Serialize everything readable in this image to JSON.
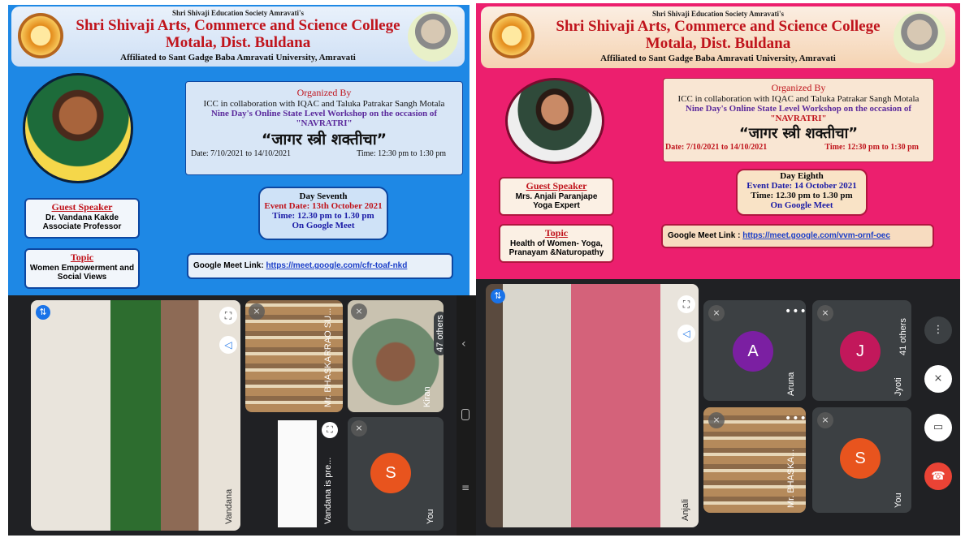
{
  "left": {
    "poster": {
      "society": "Shri Shivaji Education Society Amravati's",
      "college_line1": "Shri Shivaji Arts, Commerce and Science College",
      "college_line2": "Motala, Dist. Buldana",
      "affiliated": "Affiliated to Sant Gadge Baba Amravati University, Amravati",
      "organized_by": "Organized By",
      "collab": "ICC in collaboration with IQAC and Taluka Patrakar Sangh Motala",
      "workshop": "Nine Day's Online State Level Workshop on the occasion of",
      "navratri": "\"NAVRATRI\"",
      "marathi_title": "“जागर स्त्री शक्तीचा”",
      "date": "Date: 7/10/2021 to 14/10/2021",
      "time": "Time: 12:30 pm to 1:30 pm",
      "day": "Day Seventh",
      "event_date": "Event Date: 13th October 2021",
      "event_time": "Time: 12.30 pm  to 1.30 pm",
      "platform": "On Google Meet",
      "guest_heading": "Guest Speaker",
      "guest_name": "Dr. Vandana Kakde",
      "guest_role": "Associate Professor",
      "topic_heading": "Topic",
      "topic_line1": "Women Empowerment and",
      "topic_line2": "Social Views",
      "meet_label": "Google Meet Link:",
      "meet_url": "https://meet.google.com/cfr-toaf-nkd"
    },
    "tiles": {
      "main_name": "Vandana",
      "bhaskarrao": "Mr. BHASKARRAO SU...",
      "kiran": "Kiran",
      "others": "47 others",
      "presenting": "Vandana is pre...",
      "you_initial": "S",
      "you": "You"
    }
  },
  "right": {
    "poster": {
      "society": "Shri Shivaji Education Society Amravati's",
      "college_line1": "Shri Shivaji Arts, Commerce and Science College",
      "college_line2": "Motala, Dist. Buldana",
      "affiliated": "Affiliated to Sant Gadge Baba Amravati University, Amravati",
      "organized_by": "Organized By",
      "collab": "ICC in collaboration with IQAC and Taluka Patrakar Sangh Motala",
      "workshop": "Nine Day's Online State Level Workshop on the occasion of",
      "navratri": "\"NAVRATRI\"",
      "marathi_title": "“जागर स्त्री शक्तीचा”",
      "date": "Date: 7/10/2021 to 14/10/2021",
      "time": "Time: 12:30 pm to 1:30 pm",
      "day": "Day Eighth",
      "event_date": "Event Date: 14 October 2021",
      "event_time": "Time: 12.30 pm  to 1.30 pm",
      "platform": "On Google Meet",
      "guest_heading": "Guest Speaker",
      "guest_name": "Mrs. Anjali Paranjape",
      "guest_role": "Yoga Expert",
      "topic_heading": "Topic",
      "topic_line1": "Health of Women- Yoga,",
      "topic_line2": "Pranayam &Naturopathy",
      "meet_label": "Google Meet Link :",
      "meet_url": "https://meet.google.com/vvm-ornf-oec"
    },
    "tiles": {
      "main_name": "Anjali",
      "aruna_initial": "A",
      "aruna": "Aruna",
      "jyoti_initial": "J",
      "jyoti": "Jyoti",
      "others": "41 others",
      "bhaskarrao": "Mr. BHASKA...",
      "you_initial": "S",
      "you": "You"
    }
  },
  "colors": {
    "left_poster_bg": "#1e88e5",
    "right_poster_bg": "#ec1f6e",
    "meet_bg": "#202124",
    "tile_bg": "#3c4043",
    "avatar_purple": "#7b1fa2",
    "avatar_red": "#c2185b",
    "avatar_orange": "#e8541e",
    "end_call_red": "#ea4335"
  },
  "icons": [
    "college-logo",
    "founder-portrait",
    "fullscreen-icon",
    "audio-route-icon",
    "mic-off-icon",
    "more-options-icon",
    "camera-off-icon",
    "end-call-icon",
    "home-button-icon",
    "recents-icon",
    "back-icon"
  ]
}
